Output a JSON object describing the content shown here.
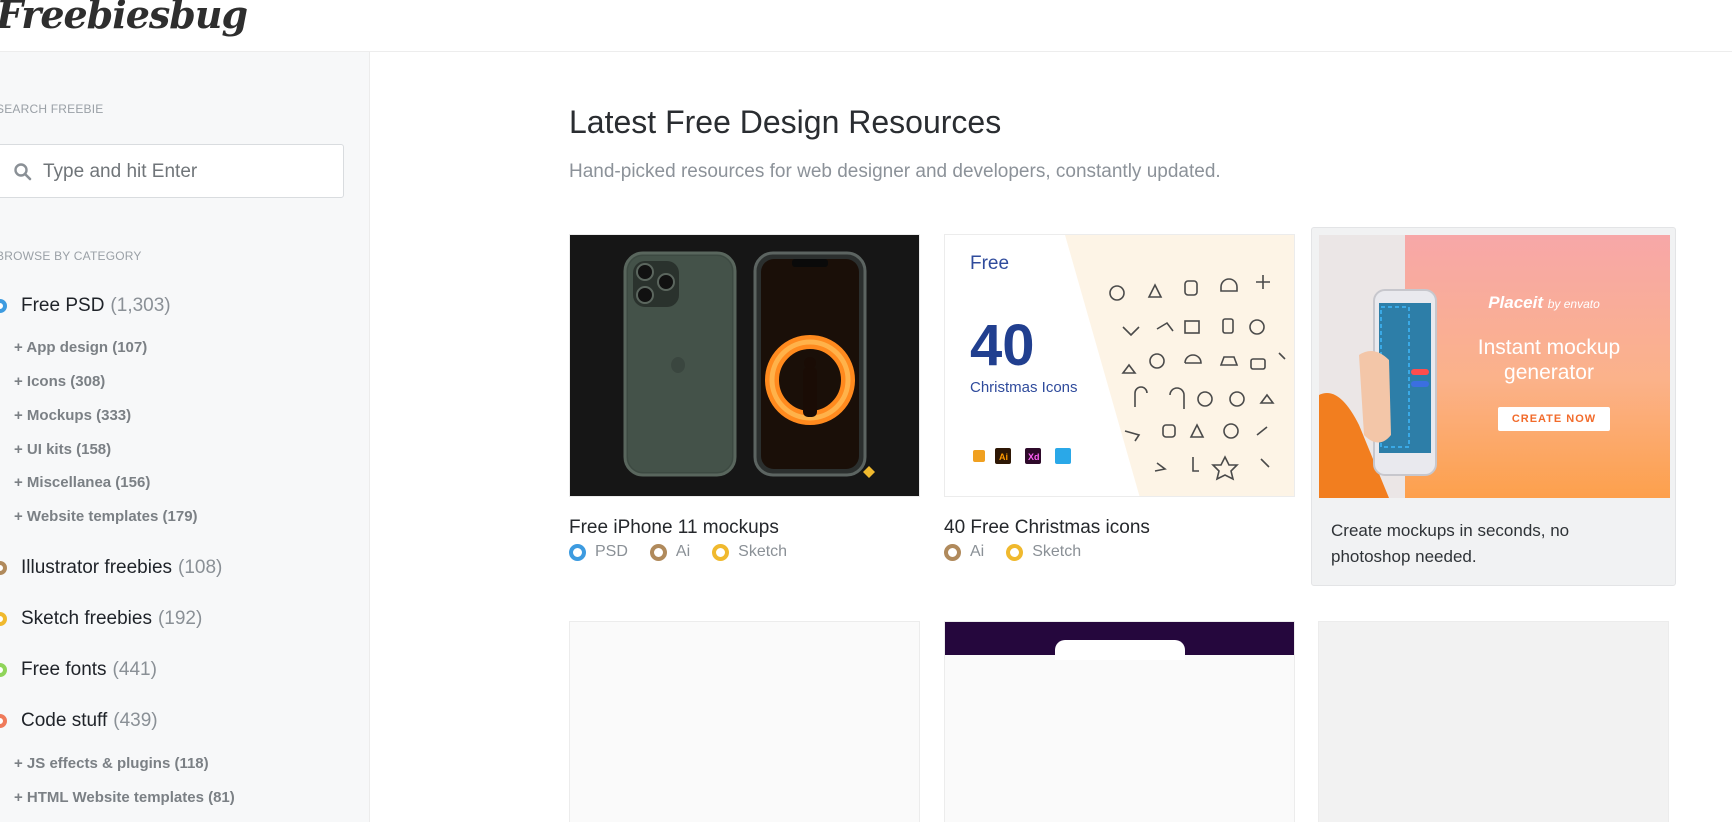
{
  "header": {
    "logo_text": "Freebiesbug"
  },
  "sidebar": {
    "search_label": "SEARCH FREEBIE",
    "search_placeholder": "Type and hit Enter",
    "browse_label": "BROWSE BY CATEGORY",
    "categories": [
      {
        "name": "Free PSD",
        "count": "(1,303)",
        "color": "#3d9be0"
      },
      {
        "name": "Illustrator freebies",
        "count": "(108)",
        "color": "#b08a5c"
      },
      {
        "name": "Sketch freebies",
        "count": "(192)",
        "color": "#f0b92e"
      },
      {
        "name": "Free fonts",
        "count": "(441)",
        "color": "#8fd45a"
      },
      {
        "name": "Code stuff",
        "count": "(439)",
        "color": "#ef7a5a"
      }
    ],
    "psd_subcategories": [
      "+ App design (107)",
      "+ Icons (308)",
      "+ Mockups (333)",
      "+ UI kits (158)",
      "+ Miscellanea (156)",
      "+ Website templates (179)"
    ],
    "code_subcategories": [
      "+ JS effects & plugins (118)",
      "+ HTML Website templates (81)"
    ]
  },
  "main": {
    "title": "Latest Free Design Resources",
    "subtitle": "Hand-picked resources for web designer and developers, constantly updated.",
    "cards": [
      {
        "title": "Free iPhone 11 mockups",
        "tags": [
          {
            "label": "PSD",
            "color": "#3d9be0"
          },
          {
            "label": "Ai",
            "color": "#b08a5c"
          },
          {
            "label": "Sketch",
            "color": "#f0b92e"
          }
        ]
      },
      {
        "title": "40 Free Christmas icons",
        "thumb_free": "Free",
        "thumb_number": "40",
        "thumb_caption": "Christmas Icons",
        "tags": [
          {
            "label": "Ai",
            "color": "#b08a5c"
          },
          {
            "label": "Sketch",
            "color": "#f0b92e"
          }
        ]
      }
    ],
    "ad": {
      "brand": "Placeit",
      "brand_suffix": "by envato",
      "headline": "Instant mockup generator",
      "cta": "CREATE NOW",
      "text": "Create mockups in seconds, no photoshop needed."
    }
  }
}
